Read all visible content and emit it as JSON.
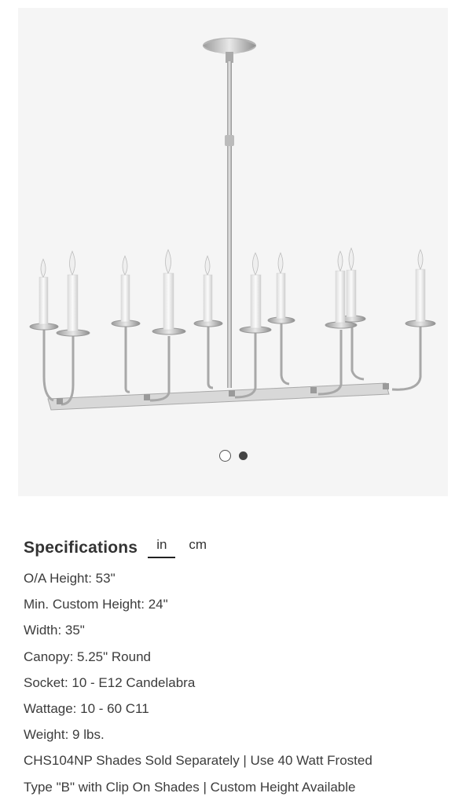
{
  "gallery": {
    "image_alt": "Linear chandelier with ten candle lights",
    "dots": [
      {
        "state": "inactive"
      },
      {
        "state": "active"
      }
    ]
  },
  "specifications": {
    "title": "Specifications",
    "units": [
      {
        "label": "in",
        "selected": true
      },
      {
        "label": "cm",
        "selected": false
      }
    ],
    "rows": [
      "O/A Height: 53\"",
      "Min. Custom Height: 24\"",
      "Width: 35\"",
      "Canopy: 5.25\" Round",
      "Socket: 10 - E12 Candelabra",
      "Wattage: 10 - 60 C11",
      "Weight: 9 lbs.",
      "CHS104NP Shades Sold Separately | Use 40 Watt Frosted",
      "Type \"B\" with Clip On Shades | Custom Height Available"
    ]
  }
}
